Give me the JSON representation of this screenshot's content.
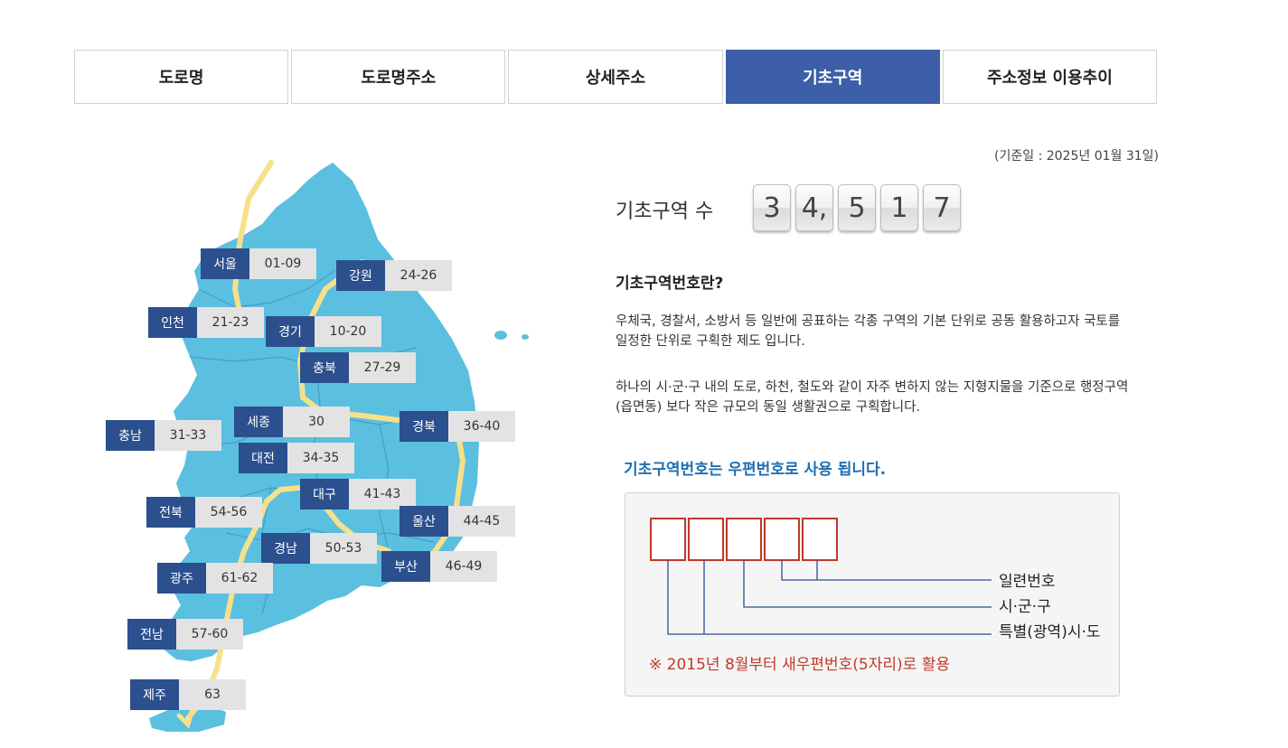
{
  "tabs": [
    {
      "label": "도로명",
      "active": false
    },
    {
      "label": "도로명주소",
      "active": false
    },
    {
      "label": "상세주소",
      "active": false
    },
    {
      "label": "기초구역",
      "active": true
    },
    {
      "label": "주소정보 이용추이",
      "active": false
    }
  ],
  "map": {
    "regions": [
      {
        "name": "서울",
        "code": "01-09"
      },
      {
        "name": "강원",
        "code": "24-26"
      },
      {
        "name": "인천",
        "code": "21-23"
      },
      {
        "name": "경기",
        "code": "10-20"
      },
      {
        "name": "충북",
        "code": "27-29"
      },
      {
        "name": "세종",
        "code": "30"
      },
      {
        "name": "경북",
        "code": "36-40"
      },
      {
        "name": "충남",
        "code": "31-33"
      },
      {
        "name": "대전",
        "code": "34-35"
      },
      {
        "name": "대구",
        "code": "41-43"
      },
      {
        "name": "전북",
        "code": "54-56"
      },
      {
        "name": "울산",
        "code": "44-45"
      },
      {
        "name": "경남",
        "code": "50-53"
      },
      {
        "name": "부산",
        "code": "46-49"
      },
      {
        "name": "광주",
        "code": "61-62"
      },
      {
        "name": "전남",
        "code": "57-60"
      },
      {
        "name": "제주",
        "code": "63"
      }
    ]
  },
  "stats": {
    "date": "(기준일 : 2025년 01월 31일)",
    "count_label": "기초구역 수",
    "digits": [
      "3",
      "4,",
      "5",
      "1",
      "7"
    ]
  },
  "info": {
    "heading": "기초구역번호란?",
    "para1_line1": "우체국, 경찰서, 소방서 등 일반에 공표하는 각종 구역의 기본 단위로 공동 활용하고자 국토를",
    "para1_line2": "일정한 단위로 구획한 제도 입니다.",
    "para2_line1": "하나의 시·군·구 내의 도로, 하천, 철도와 같이 자주 변하지 않는 지형지물을 기준으로 행정구역",
    "para2_line2": "(읍면동) 보다 작은 규모의 동일 생활권으로 구획합니다."
  },
  "postal": {
    "title": "기초구역번호는 우편번호로 사용 됩니다.",
    "label_serial": "일련번호",
    "label_sigungu": "시·군·구",
    "label_sido": "특별(광역)시·도",
    "note": "※  2015년 8월부터  새우편번호(5자리)로 활용"
  },
  "colors": {
    "tab_active": "#3d5ea8",
    "map_fill": "#5bbfe0",
    "route": "#f7e08a",
    "region_name_bg": "#2c4f8e",
    "region_code_bg": "#e3e3e3",
    "title_blue": "#1f6fb2",
    "box_red": "#c0392b"
  }
}
